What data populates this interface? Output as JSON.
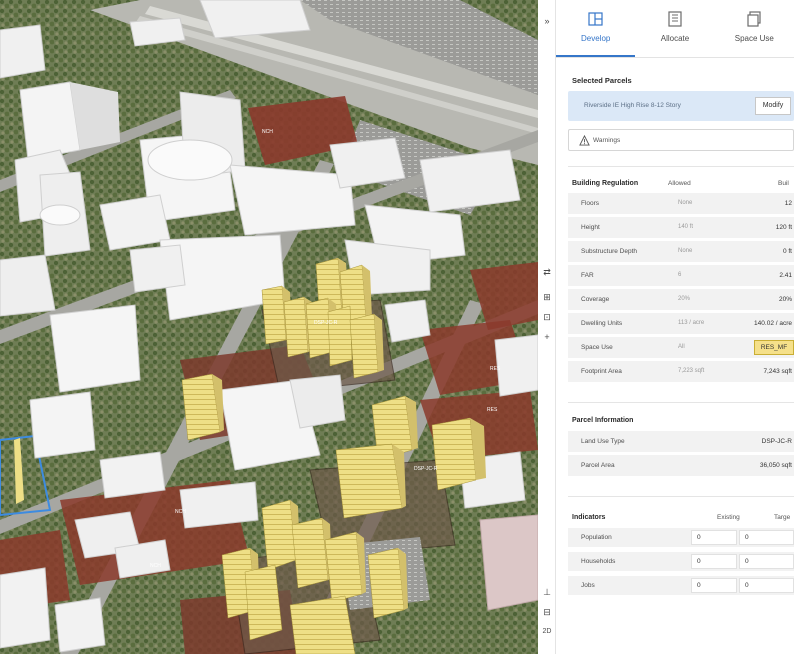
{
  "map": {
    "parcel_labels": [
      "NCH",
      "DSP-JC-R",
      "RES",
      "RES",
      "DSP-JC-R",
      "NCH",
      "NCH"
    ]
  },
  "tools": {
    "top": [
      "»"
    ],
    "right": [
      "⇄",
      "⊞",
      "⊡",
      "+"
    ],
    "bottom": [
      "⊥",
      "⊟",
      "2D"
    ]
  },
  "panel": {
    "tabs": [
      {
        "label": "Develop",
        "icon": "develop-icon",
        "active": true
      },
      {
        "label": "Allocate",
        "icon": "allocate-icon",
        "active": false
      },
      {
        "label": "Space Use",
        "icon": "space-use-icon",
        "active": false
      }
    ],
    "selected_title": "Selected Parcels",
    "parcel_name": "Riverside IE High Rise 8-12 Story",
    "modify_label": "Modify",
    "warnings_label": "Warnings",
    "regulation": {
      "header": "Building Regulation",
      "col_allowed": "Allowed",
      "col_built": "Buil",
      "rows": [
        {
          "label": "Floors",
          "allowed": "None",
          "built": "12"
        },
        {
          "label": "Height",
          "allowed": "140 ft",
          "built": "120 ft"
        },
        {
          "label": "Substructure Depth",
          "allowed": "None",
          "built": "0 ft"
        },
        {
          "label": "FAR",
          "allowed": "6",
          "built": "2.41"
        },
        {
          "label": "Coverage",
          "allowed": "20%",
          "built": "20%"
        },
        {
          "label": "Dwelling Units",
          "allowed": "113 / acre",
          "built": "140.02 / acre"
        },
        {
          "label": "Space Use",
          "allowed": "All",
          "built": "RES_MF"
        },
        {
          "label": "Footprint Area",
          "allowed": "7,223 sqft",
          "built": "7,243 sqft"
        }
      ]
    },
    "parcel_info": {
      "header": "Parcel Information",
      "rows": [
        {
          "label": "Land Use Type",
          "value": "DSP-JC-R"
        },
        {
          "label": "Parcel Area",
          "value": "36,050 sqft"
        }
      ]
    },
    "indicators": {
      "header": "Indicators",
      "col_existing": "Existing",
      "col_target": "Targe",
      "rows": [
        {
          "label": "Population",
          "existing": "0",
          "target": "0"
        },
        {
          "label": "Households",
          "existing": "0",
          "target": "0"
        },
        {
          "label": "Jobs",
          "existing": "0",
          "target": "0"
        }
      ]
    }
  },
  "colors": {
    "accent": "#3576c9",
    "highlight_building": "#efe08a",
    "highlight_badge": "#f5e08a",
    "parcel_red": "#8b3a2c",
    "building_white": "#f2f2f2"
  }
}
